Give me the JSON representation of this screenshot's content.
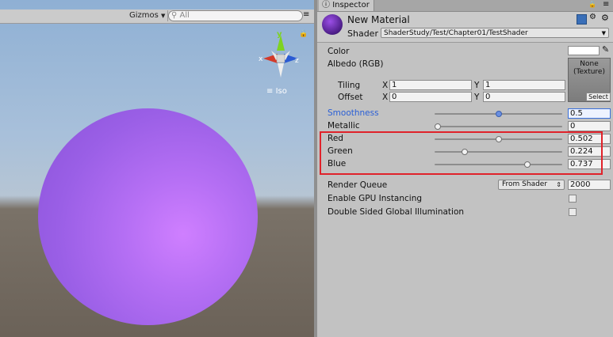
{
  "scene": {
    "gizmos_label": "Gizmos",
    "search_placeholder": "All",
    "axis_y": "y",
    "axis_x": "x",
    "axis_z": "z",
    "projection_label": "Iso"
  },
  "inspector": {
    "tab_label": "Inspector",
    "material_name": "New Material",
    "shader_label": "Shader",
    "shader_value": "ShaderStudy/Test/Chapter01/TestShader"
  },
  "properties": {
    "color_label": "Color",
    "albedo_label": "Albedo (RGB)",
    "texture_line1": "None",
    "texture_line2": "(Texture)",
    "texture_select": "Select",
    "tiling_label": "Tiling",
    "offset_label": "Offset",
    "x_label": "X",
    "y_label": "Y",
    "tiling_x": "1",
    "tiling_y": "1",
    "offset_x": "0",
    "offset_y": "0",
    "sliders": [
      {
        "label": "Smoothness",
        "value": "0.5",
        "fraction": 0.5
      },
      {
        "label": "Metallic",
        "value": "0",
        "fraction": 0.0
      },
      {
        "label": "Red",
        "value": "0.502",
        "fraction": 0.502
      },
      {
        "label": "Green",
        "value": "0.224",
        "fraction": 0.224
      },
      {
        "label": "Blue",
        "value": "0.737",
        "fraction": 0.737
      }
    ],
    "render_queue_label": "Render Queue",
    "render_queue_mode": "From Shader",
    "render_queue_value": "2000",
    "gpu_instancing_label": "Enable GPU Instancing",
    "double_sided_gi_label": "Double Sided Global Illumination"
  },
  "colors": {
    "highlight_box": "#e0222a",
    "smoothness_label": "#2a5fd6",
    "sphere": "#a865ee"
  }
}
